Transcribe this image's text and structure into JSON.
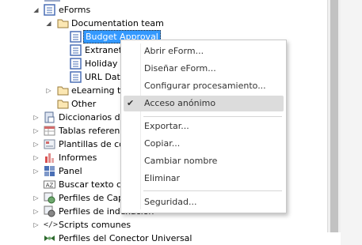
{
  "tree": {
    "items": [
      {
        "label": "eForms"
      },
      {
        "label": "Documentation team"
      },
      {
        "label": "Budget Approval"
      },
      {
        "label": "Extranet a"
      },
      {
        "label": "Holiday F"
      },
      {
        "label": "URL Data"
      },
      {
        "label": "eLearning tea"
      },
      {
        "label": "Other"
      },
      {
        "label": "Diccionarios de p"
      },
      {
        "label": "Tablas referencia"
      },
      {
        "label": "Plantillas de con"
      },
      {
        "label": "Informes"
      },
      {
        "label": "Panel"
      },
      {
        "label": "Buscar texto con"
      },
      {
        "label": "Perfiles de Captu"
      },
      {
        "label": "Perfiles de indexación"
      },
      {
        "label": "Scripts comunes"
      },
      {
        "label": "Perfiles del Conector Universal"
      }
    ]
  },
  "context_menu": {
    "items": [
      {
        "label": "Abrir eForm..."
      },
      {
        "label": "Diseñar eForm..."
      },
      {
        "label": "Configurar procesamiento..."
      },
      {
        "label": "Acceso anónimo",
        "checked": true
      },
      {
        "label": "Exportar..."
      },
      {
        "label": "Copiar..."
      },
      {
        "label": "Cambiar nombre"
      },
      {
        "label": "Eliminar"
      },
      {
        "label": "Seguridad..."
      }
    ]
  },
  "icons": {
    "folder": "folder-icon",
    "form": "form-icon",
    "dictionary": "dictionary-icon",
    "table": "table-icon",
    "template": "template-icon",
    "report": "bar-chart-icon",
    "panel": "panel-icon",
    "search_text": "az-search-icon",
    "capture_profile": "capture-profile-icon",
    "index_profile": "index-profile-icon",
    "scripts": "code-icon",
    "connector": "connector-icon"
  },
  "colors": {
    "selection": "#3399ff",
    "menu_hover": "#dcdcdc",
    "form_icon": "#4a6fb5",
    "folder_fill": "#fbe7b3"
  }
}
